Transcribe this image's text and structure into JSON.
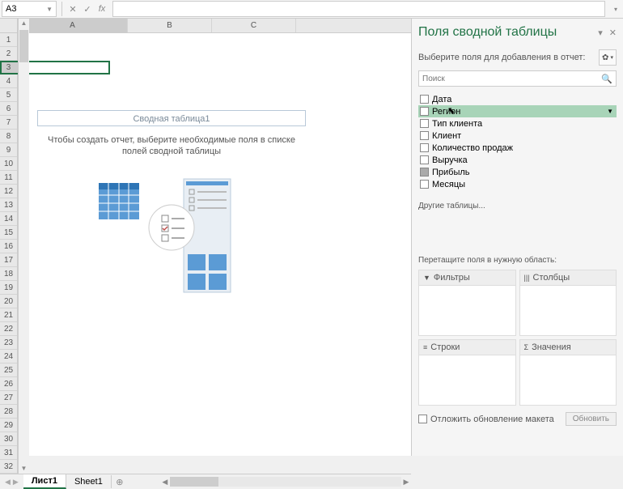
{
  "formula_bar": {
    "name_box": "A3",
    "cancel": "✕",
    "confirm": "✓",
    "fx": "fx"
  },
  "columns": {
    "A": "A",
    "B": "B",
    "C": "C"
  },
  "pivot_placeholder": {
    "title": "Сводная таблица1",
    "text": "Чтобы создать отчет, выберите необходимые поля в списке полей сводной таблицы"
  },
  "sheet_tabs": {
    "active": "Лист1",
    "other": "Sheet1"
  },
  "panel": {
    "title": "Поля сводной таблицы",
    "prompt": "Выберите поля для добавления в отчет:",
    "search_placeholder": "Поиск",
    "fields": [
      {
        "label": "Дата",
        "hover": false,
        "checked": false,
        "filled": false
      },
      {
        "label": "Регион",
        "hover": true,
        "checked": false,
        "filled": false
      },
      {
        "label": "Тип клиента",
        "hover": false,
        "checked": false,
        "filled": false
      },
      {
        "label": "Клиент",
        "hover": false,
        "checked": false,
        "filled": false
      },
      {
        "label": "Количество продаж",
        "hover": false,
        "checked": false,
        "filled": false
      },
      {
        "label": "Выручка",
        "hover": false,
        "checked": false,
        "filled": false
      },
      {
        "label": "Прибыль",
        "hover": false,
        "checked": false,
        "filled": true
      },
      {
        "label": "Месяцы",
        "hover": false,
        "checked": false,
        "filled": false
      }
    ],
    "other_tables": "Другие таблицы...",
    "drag_prompt": "Перетащите поля в нужную область:",
    "areas": {
      "filters": "Фильтры",
      "columns": "Столбцы",
      "rows": "Строки",
      "values": "Значения"
    },
    "defer": "Отложить обновление макета",
    "update": "Обновить"
  }
}
